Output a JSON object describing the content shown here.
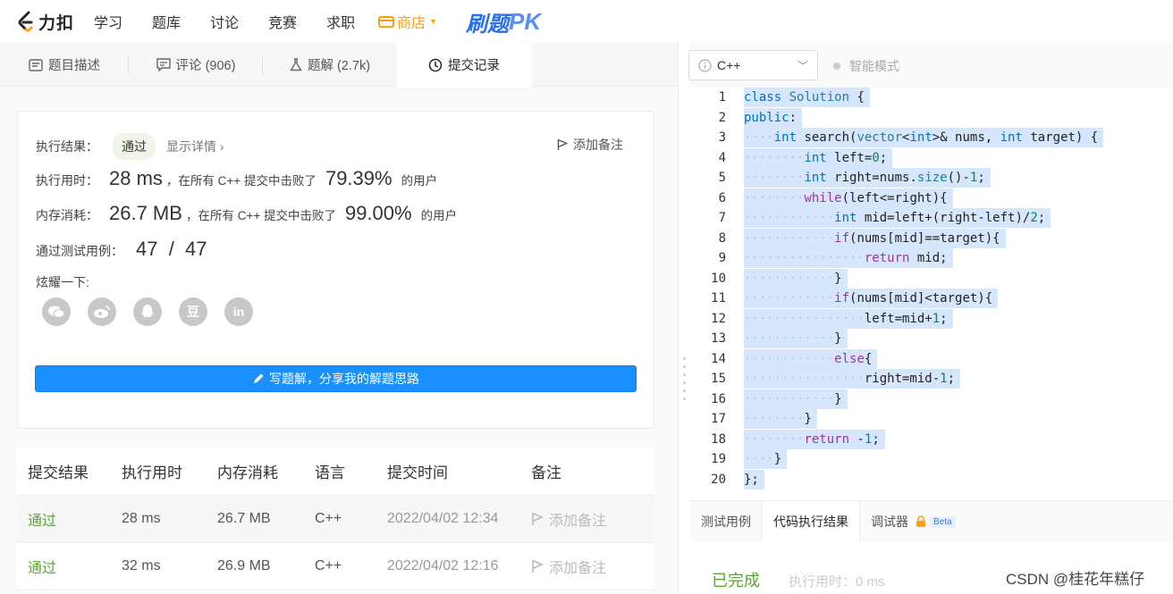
{
  "topnav": {
    "logo_text": "力扣",
    "items": [
      "学习",
      "题库",
      "讨论",
      "竞赛",
      "求职"
    ],
    "shop_label": "商店",
    "pk_label": "刷题",
    "pk_label2": "PK"
  },
  "tabs": [
    {
      "label": "题目描述",
      "icon": "description-icon"
    },
    {
      "label": "评论 (906)",
      "icon": "comment-icon"
    },
    {
      "label": "题解 (2.7k)",
      "icon": "flask-icon"
    },
    {
      "label": "提交记录",
      "icon": "clock-icon"
    }
  ],
  "result_card": {
    "result_label": "执行结果：",
    "result_value": "通过",
    "detail_link": "显示详情 ›",
    "add_note": "添加备注",
    "time_label": "执行用时：",
    "time_value": "28 ms",
    "time_text": "，在所有 C++ 提交中击败了",
    "time_pct": "79.39%",
    "time_suffix": "的用户",
    "mem_label": "内存消耗：",
    "mem_value": "26.7 MB",
    "mem_text": "，在所有 C++ 提交中击败了",
    "mem_pct": "99.00%",
    "mem_suffix": "的用户",
    "cases_label": "通过测试用例：",
    "cases_value": "47  /  47",
    "share_label": "炫耀一下:",
    "share_icons": [
      "wechat-icon",
      "weibo-icon",
      "qq-icon",
      "douban-icon",
      "linkedin-icon"
    ],
    "share_glyphs": [
      "",
      "",
      "",
      "豆",
      "in"
    ],
    "write_button": "写题解，分享我的解题思路"
  },
  "submissions": {
    "headers": [
      "提交结果",
      "执行用时",
      "内存消耗",
      "语言",
      "提交时间",
      "备注"
    ],
    "rows": [
      {
        "status": "通过",
        "time": "28 ms",
        "memory": "26.7 MB",
        "lang": "C++",
        "date": "2022/04/02 12:34",
        "note": "添加备注"
      },
      {
        "status": "通过",
        "time": "32 ms",
        "memory": "26.9 MB",
        "lang": "C++",
        "date": "2022/04/02 12:16",
        "note": "添加备注"
      }
    ]
  },
  "editor": {
    "language": "C++",
    "smart_mode": "智能模式"
  },
  "bottom_tabs": [
    "测试用例",
    "代码执行结果",
    "调试器"
  ],
  "beta_label": "Beta",
  "result_pane": {
    "status": "已完成",
    "exec_time": "执行用时：0 ms"
  },
  "watermark": "CSDN @桂花年糕仔"
}
